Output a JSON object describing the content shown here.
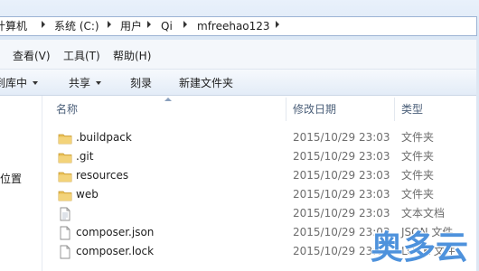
{
  "address": {
    "crumbs": [
      "计算机",
      "系统 (C:)",
      "用户",
      "Qi",
      "mfreehao123"
    ]
  },
  "menubar": {
    "items": [
      "查看(V)",
      "工具(T)",
      "帮助(H)"
    ]
  },
  "toolbar": {
    "library_fragment": "到库中",
    "share": "共享",
    "burn": "刻录",
    "new_folder": "新建文件夹"
  },
  "nav": {
    "fragment": "位置"
  },
  "columns": {
    "name": "名称",
    "modified": "修改日期",
    "type": "类型"
  },
  "files": [
    {
      "name": ".buildpack",
      "date": "2015/10/29 23:03",
      "type": "文件夹",
      "icon": "folder-icon"
    },
    {
      "name": ".git",
      "date": "2015/10/29 23:03",
      "type": "文件夹",
      "icon": "folder-icon"
    },
    {
      "name": "resources",
      "date": "2015/10/29 23:03",
      "type": "文件夹",
      "icon": "folder-icon"
    },
    {
      "name": "web",
      "date": "2015/10/29 23:03",
      "type": "文件夹",
      "icon": "folder-icon"
    },
    {
      "name": "",
      "date": "2015/10/29 23:03",
      "type": "文本文档",
      "icon": "text-document-icon"
    },
    {
      "name": "composer.json",
      "date": "2015/10/29 23:03",
      "type": "JSON 文件",
      "icon": "file-icon"
    },
    {
      "name": "composer.lock",
      "date": "2015/10/29 23:03",
      "type": "LOCK 文件",
      "icon": "file-icon"
    }
  ],
  "watermark": {
    "text": "奥多云",
    "color": "#2f7fd6"
  },
  "colors": {
    "folder": "#e8bf55",
    "accent_border": "#9cb3d4"
  }
}
